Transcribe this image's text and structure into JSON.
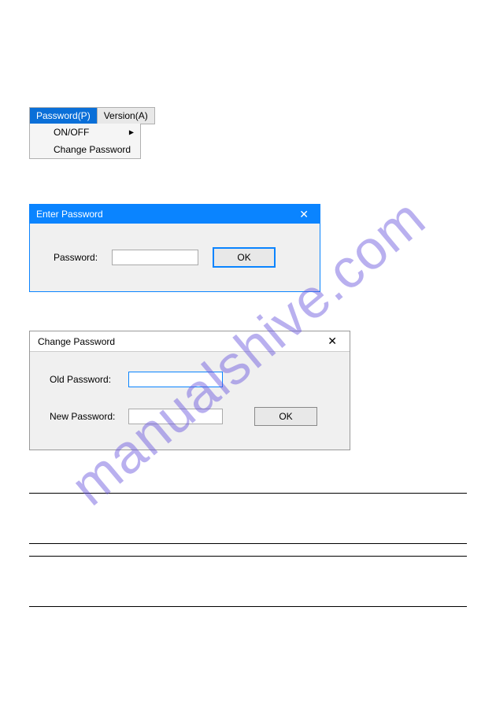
{
  "watermark": "manualshive.com",
  "menu": {
    "tab_password": "Password(P)",
    "tab_version": "Version(A)",
    "item_onoff": "ON/OFF",
    "item_change": "Change Password"
  },
  "enter_dialog": {
    "title": "Enter Password",
    "label_password": "Password:",
    "value": "",
    "ok_label": "OK"
  },
  "change_dialog": {
    "title": "Change Password",
    "label_old": "Old Password:",
    "value_old": "",
    "label_new": "New Password:",
    "value_new": "",
    "ok_label": "OK"
  }
}
